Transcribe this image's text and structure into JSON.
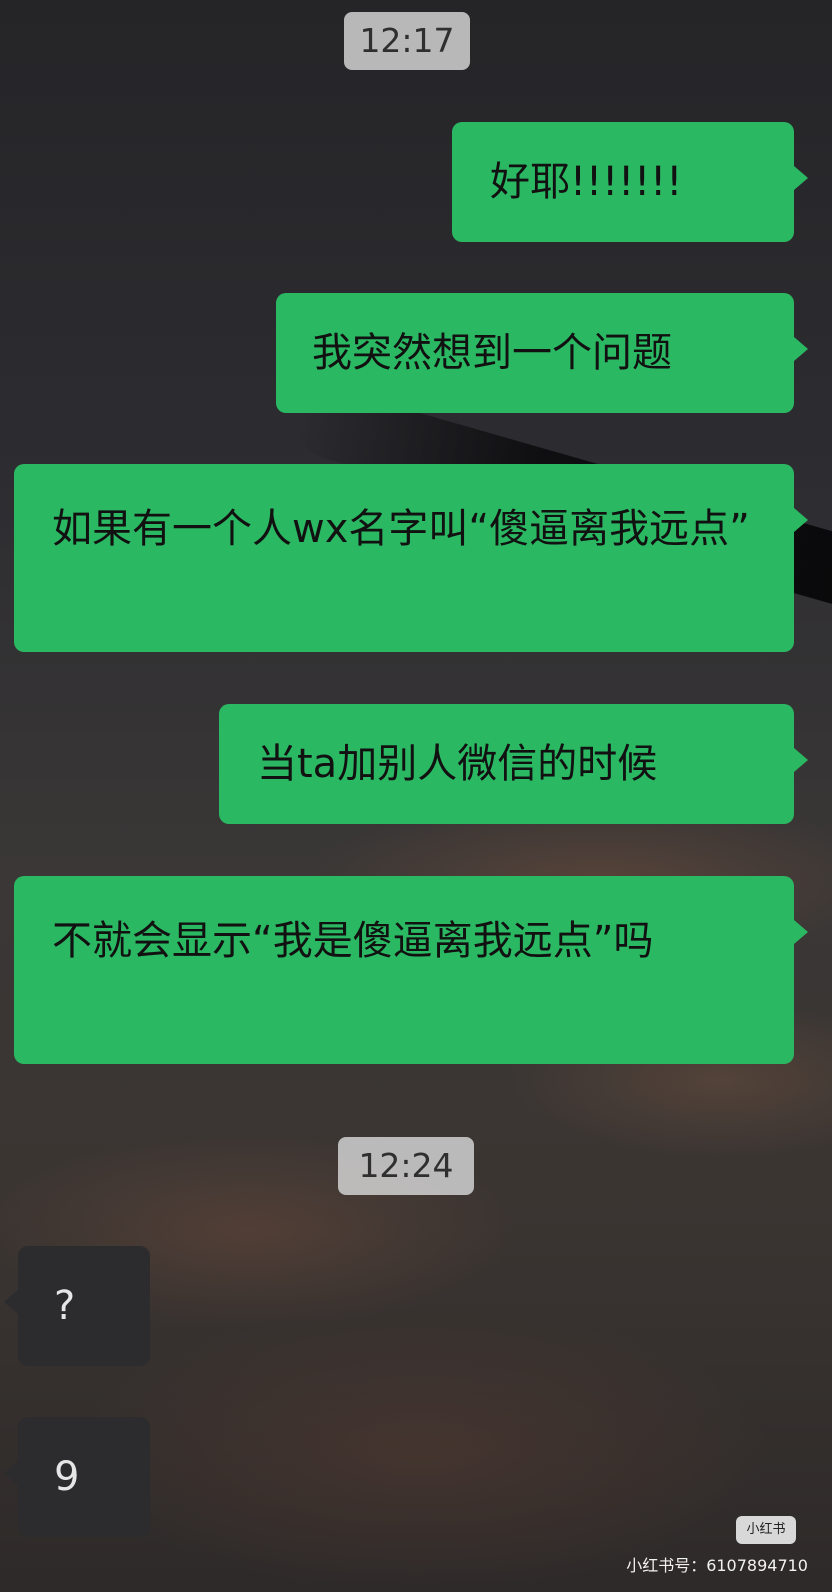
{
  "chat": {
    "timestamps": [
      "12:17",
      "12:24"
    ],
    "messages": [
      {
        "side": "sent",
        "text": "好耶!!!!!!!"
      },
      {
        "side": "sent",
        "text": "我突然想到一个问题"
      },
      {
        "side": "sent",
        "text": "如果有一个人wx名字叫“傻逼离我远点”"
      },
      {
        "side": "sent",
        "text": "当ta加别人微信的时候"
      },
      {
        "side": "sent",
        "text": "不就会显示“我是傻逼离我远点”吗"
      },
      {
        "side": "received",
        "text": "?"
      },
      {
        "side": "received",
        "text": "9"
      }
    ]
  },
  "watermark": {
    "logo": "小红书",
    "id": "小红书号：6107894710"
  },
  "colors": {
    "sent_bubble": "#2bb863",
    "received_bubble": "#2c2c2e",
    "timestamp_bg": "#cdcdcd"
  }
}
